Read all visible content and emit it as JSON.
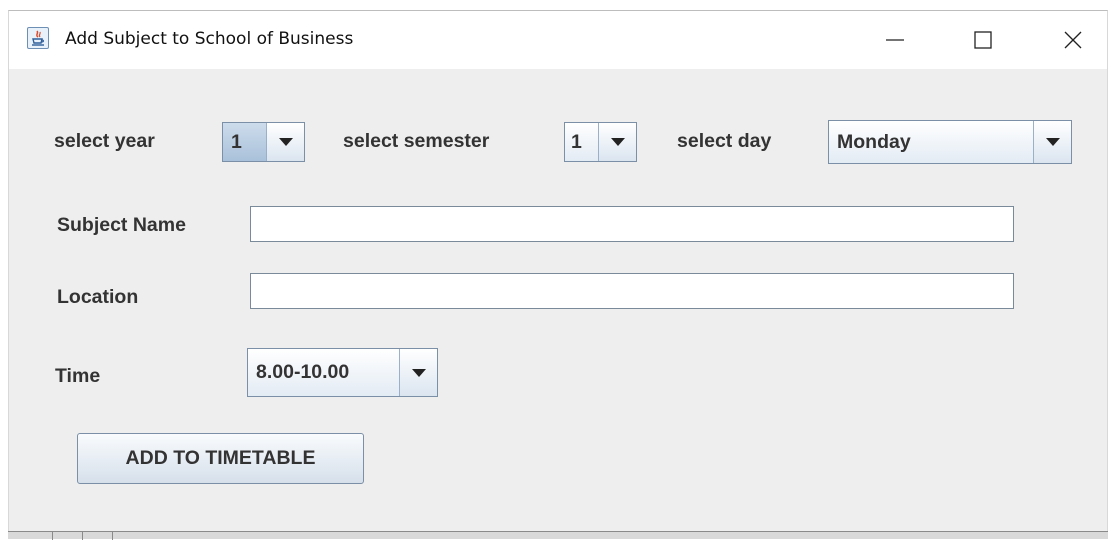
{
  "window": {
    "title": "Add Subject to School of Business",
    "controls": {
      "minimize": "minimize-icon",
      "maximize": "maximize-icon",
      "close": "close-icon"
    }
  },
  "form": {
    "year": {
      "label": "select year",
      "selected": "1"
    },
    "semester": {
      "label": "select semester",
      "selected": "1"
    },
    "day": {
      "label": "select day",
      "selected": "Monday"
    },
    "subject_name": {
      "label": "Subject Name",
      "value": ""
    },
    "location": {
      "label": "Location",
      "value": ""
    },
    "time": {
      "label": "Time",
      "selected": "8.00-10.00"
    },
    "submit_label": "ADD TO TIMETABLE"
  },
  "colors": {
    "window_bg": "#eeeeee",
    "titlebar_bg": "#ffffff",
    "control_border": "#7b8fa6",
    "selected_year_bg": "#b8cfe5"
  }
}
